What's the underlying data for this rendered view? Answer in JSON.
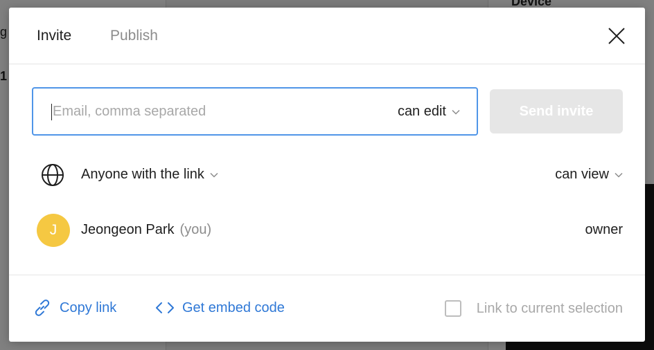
{
  "background": {
    "left_glyph": "g",
    "left_glyph_2": "1",
    "right_heading": "Device"
  },
  "tabs": [
    {
      "label": "Invite",
      "active": true
    },
    {
      "label": "Publish",
      "active": false
    }
  ],
  "invite": {
    "placeholder": "Email, comma separated",
    "permission": "can edit",
    "send_label": "Send invite"
  },
  "link_access": {
    "label": "Anyone with the link",
    "permission": "can view"
  },
  "user": {
    "initial": "J",
    "name": "Jeongeon Park",
    "suffix": "(you)",
    "role": "owner"
  },
  "footer": {
    "copy_link": "Copy link",
    "embed_code": "Get embed code",
    "checkbox_label": "Link to current selection",
    "checkbox_checked": false
  },
  "colors": {
    "accent": "#2f78d6",
    "focus_border": "#4f95e8",
    "avatar": "#f5c842",
    "button_disabled": "#e6e6e6"
  },
  "icons": [
    "close-icon",
    "chevron-down-icon",
    "globe-icon",
    "link-icon",
    "code-icon"
  ]
}
